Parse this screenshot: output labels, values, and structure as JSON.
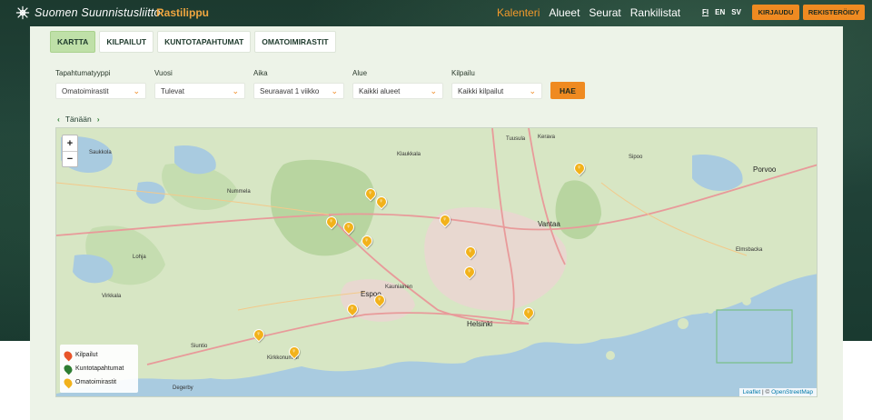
{
  "header": {
    "org_name": "Suomen Suunnistusliitto",
    "product": "Rastilippu",
    "nav": [
      "Kalenteri",
      "Alueet",
      "Seurat",
      "Rankilistat"
    ],
    "nav_active": "Kalenteri",
    "languages": [
      "FI",
      "EN",
      "SV"
    ],
    "language_active": "FI",
    "login_label": "KIRJAUDU",
    "register_label": "REKISTERÖIDY",
    "accent_color": "#ef8a21"
  },
  "tabs": [
    {
      "label": "KARTTA",
      "active": true
    },
    {
      "label": "KILPAILUT",
      "active": false
    },
    {
      "label": "KUNTOTAPAHTUMAT",
      "active": false
    },
    {
      "label": "OMATOIMIRASTIT",
      "active": false
    }
  ],
  "filters": [
    {
      "label": "Tapahtumatyyppi",
      "value": "Omatoimirastit"
    },
    {
      "label": "Vuosi",
      "value": "Tulevat"
    },
    {
      "label": "Aika",
      "value": "Seuraavat 1 viikko"
    },
    {
      "label": "Alue",
      "value": "Kaikki alueet"
    },
    {
      "label": "Kilpailu",
      "value": "Kaikki kilpailut"
    }
  ],
  "search_label": "HAE",
  "date_nav": {
    "label": "Tänään",
    "prev_icon": "chevron-left-icon",
    "next_icon": "chevron-right-icon"
  },
  "map": {
    "zoom_in": "+",
    "zoom_out": "−",
    "place_labels": [
      "Saukkola",
      "Nummela",
      "Klaukkala",
      "Tuusula",
      "Kerava",
      "Porvoo",
      "Sipoo",
      "Vantaa",
      "Lohja",
      "Espoo",
      "Kauniainen",
      "Helsinki",
      "Siuntio",
      "Kirkkonummi",
      "Degerby",
      "Virkkala",
      "Elmsbacka"
    ],
    "legend": [
      {
        "label": "Kilpailut",
        "color": "#e8552a"
      },
      {
        "label": "Kuntotapahtumat",
        "color": "#2e7d32"
      },
      {
        "label": "Omatoimirastit",
        "color": "#f2b21b"
      }
    ],
    "attribution": {
      "leaflet": "Leaflet",
      "separator": " | © ",
      "osm": "OpenStreetMap"
    },
    "marker_count": 14
  }
}
